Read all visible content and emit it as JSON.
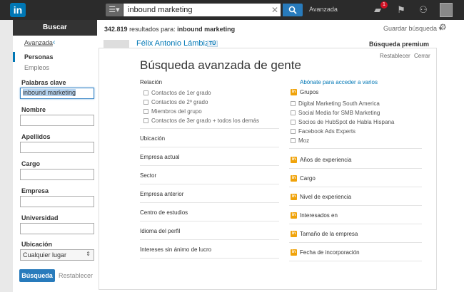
{
  "nav": {
    "logo": "in",
    "search_category_icon": "list-icon",
    "search_value": "inbound marketing",
    "advanced_label": "Avanzada",
    "notification_count": "1"
  },
  "sidebar": {
    "search_button": "Buscar",
    "advanced_tab": "Avanzada",
    "type_selected": "Personas",
    "type_other": "Empleos",
    "fields": [
      {
        "label": "Palabras clave",
        "value": "inbound marketing"
      },
      {
        "label": "Nombre",
        "value": ""
      },
      {
        "label": "Apellidos",
        "value": ""
      },
      {
        "label": "Cargo",
        "value": ""
      },
      {
        "label": "Empresa",
        "value": ""
      },
      {
        "label": "Universidad",
        "value": ""
      }
    ],
    "location_label": "Ubicación",
    "location_value": "Cualquier lugar",
    "submit_label": "Búsqueda",
    "reset_label": "Restablecer"
  },
  "results": {
    "count": "342.819",
    "count_text": "resultados para:",
    "query": "inbound marketing",
    "save_search": "Guardar búsqueda",
    "first_name": "Félix Antonio Lámbiz",
    "you_badge": "TÚ",
    "premium_peek": "Búsqueda premium"
  },
  "panel": {
    "title": "Búsqueda avanzada de gente",
    "reset": "Restablecer",
    "close": "Cerrar",
    "relation_label": "Relación",
    "relation_options": [
      "Contactos de 1er grado",
      "Contactos de 2º grado",
      "Miembros del grupo",
      "Contactos de 3er grado + todos los demás"
    ],
    "left_fields": [
      "Ubicación",
      "Empresa actual",
      "Sector",
      "Empresa anterior",
      "Centro de estudios",
      "Idioma del perfil",
      "Intereses sin ánimo de lucro"
    ],
    "premium_link": "Abónate para acceder a varios",
    "groups_label": "Grupos",
    "groups": [
      "Digital Marketing South America",
      "Social Media for SMB Marketing",
      "Socios de HubSpot de Habla Hispana",
      "Facebook Ads Experts",
      "Moz"
    ],
    "premium_fields": [
      "Años de experiencia",
      "Cargo",
      "Nivel de experiencia",
      "Interesados en",
      "Tamaño de la empresa",
      "Fecha de incorporación"
    ],
    "premium_badge": "in"
  }
}
